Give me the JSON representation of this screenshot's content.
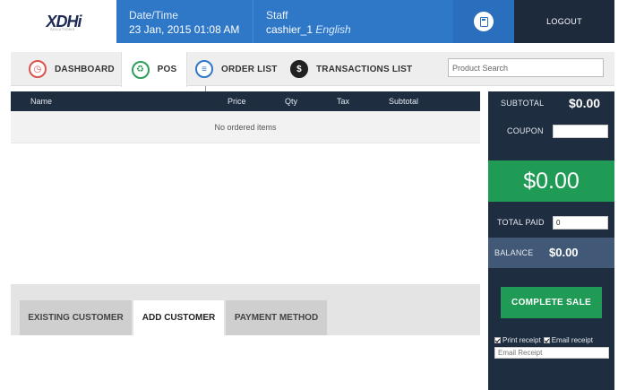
{
  "header": {
    "logo_text": "XDHi",
    "logo_subtext": "SOLUTIONS",
    "date_label": "Date/Time",
    "date_value": "23 Jan, 2015 01:08 AM",
    "staff_label": "Staff",
    "staff_name": "cashier_1",
    "staff_language": "English",
    "calculator_icon": "calculator-icon",
    "logout_label": "LOGOUT",
    "colors": {
      "blue": "#2f78c8",
      "dark": "#1c2a3c"
    }
  },
  "nav": {
    "tabs": [
      {
        "label": "DASHBOARD",
        "icon": "speedometer-icon"
      },
      {
        "label": "POS",
        "icon": "cart-icon"
      },
      {
        "label": "ORDER LIST",
        "icon": "list-icon"
      },
      {
        "label": "TRANSACTIONS LIST",
        "icon": "money-icon"
      }
    ],
    "active_tab": "POS",
    "search_placeholder": "Product Search"
  },
  "order_table": {
    "columns": [
      "Name",
      "Price",
      "Qty",
      "Tax",
      "Subtotal"
    ],
    "empty_text": "No ordered items"
  },
  "bottom_tabs": {
    "tabs": [
      "EXISTING CUSTOMER",
      "ADD CUSTOMER",
      "PAYMENT METHOD"
    ],
    "active_tab": "ADD CUSTOMER"
  },
  "panel": {
    "subtotal_label": "SUBTOTAL",
    "subtotal_value": "$0.00",
    "coupon_label": "COUPON",
    "coupon_value": "",
    "total_value": "$0.00",
    "total_paid_label": "TOTAL PAID",
    "total_paid_value": "0",
    "balance_label": "BALANCE",
    "balance_value": "$0.00",
    "complete_label": "COMPLETE SALE",
    "print_receipt_label": "Print receipt",
    "email_receipt_label": "Email receipt",
    "print_receipt_checked": true,
    "email_receipt_checked": true,
    "email_placeholder": "Email Receipt",
    "colors": {
      "green": "#1f9b55",
      "panel": "#1f2d40",
      "balance": "#415876"
    }
  }
}
